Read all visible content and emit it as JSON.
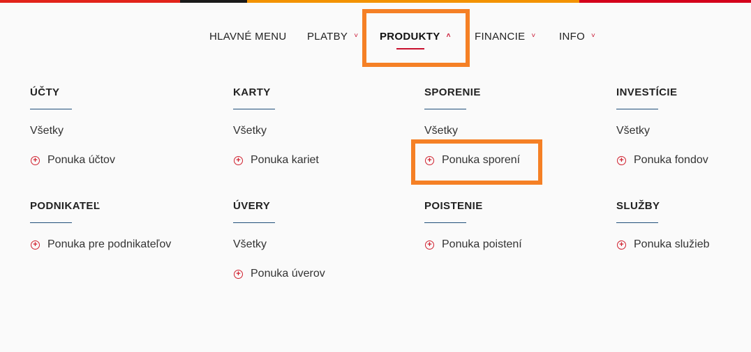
{
  "colors": {
    "accent": "#c8102e",
    "highlight": "#f58025",
    "rule": "#1f4e79",
    "stripe": [
      "#e2231a",
      "#1a1a1a",
      "#f39200",
      "#d4001b"
    ]
  },
  "nav": {
    "items": [
      {
        "label": "HLAVNÉ MENU",
        "has_chevron": false
      },
      {
        "label": "PLATBY",
        "has_chevron": true,
        "chevron": "˅"
      },
      {
        "label": "PRODUKTY",
        "has_chevron": true,
        "chevron": "˄",
        "active": true
      },
      {
        "label": "FINANCIE",
        "has_chevron": true,
        "chevron": "˅"
      },
      {
        "label": "INFO",
        "has_chevron": true,
        "chevron": "˅"
      }
    ]
  },
  "icons": {
    "plus": "circle-plus-icon",
    "chevron_down": "chevron-down-icon",
    "chevron_up": "chevron-up-icon"
  },
  "categories": [
    {
      "title": "ÚČTY",
      "links": [
        {
          "label": "Všetky"
        },
        {
          "label": "Ponuka účtov",
          "icon": true
        }
      ]
    },
    {
      "title": "KARTY",
      "links": [
        {
          "label": "Všetky"
        },
        {
          "label": "Ponuka kariet",
          "icon": true
        }
      ]
    },
    {
      "title": "SPORENIE",
      "links": [
        {
          "label": "Všetky"
        },
        {
          "label": "Ponuka sporení",
          "icon": true
        }
      ]
    },
    {
      "title": "INVESTÍCIE",
      "links": [
        {
          "label": "Všetky"
        },
        {
          "label": "Ponuka fondov",
          "icon": true
        }
      ]
    },
    {
      "title": "PODNIKATEĽ",
      "links": [
        {
          "label": "Ponuka pre podnikateľov",
          "icon": true
        }
      ]
    },
    {
      "title": "ÚVERY",
      "links": [
        {
          "label": "Všetky"
        },
        {
          "label": "Ponuka úverov",
          "icon": true
        }
      ]
    },
    {
      "title": "POISTENIE",
      "links": [
        {
          "label": "Ponuka poistení",
          "icon": true
        }
      ]
    },
    {
      "title": "SLUŽBY",
      "links": [
        {
          "label": "Ponuka služieb",
          "icon": true
        }
      ]
    }
  ]
}
